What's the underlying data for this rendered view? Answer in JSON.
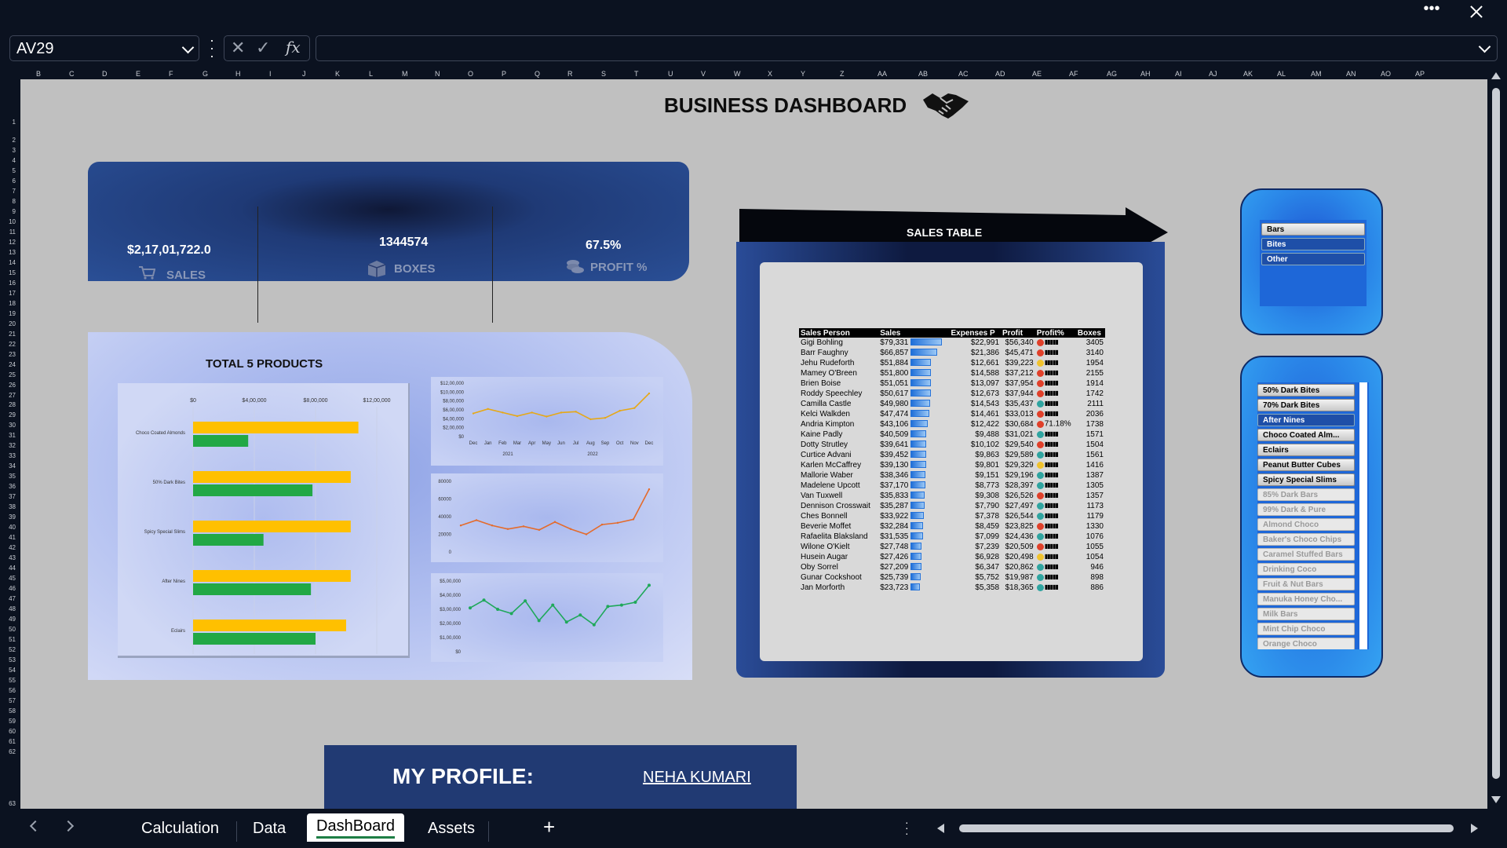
{
  "formula_bar": {
    "name_box": "AV29",
    "fx_label": "fx",
    "formula": ""
  },
  "columns": [
    "B",
    "C",
    "D",
    "E",
    "F",
    "G",
    "H",
    "I",
    "J",
    "K",
    "L",
    "M",
    "N",
    "O",
    "P",
    "Q",
    "R",
    "S",
    "T",
    "U",
    "V",
    "W",
    "X",
    "Y",
    "Z",
    "AA",
    "AB",
    "AC",
    "AD",
    "AE",
    "AF",
    "AG",
    "AH",
    "AI",
    "AJ",
    "AK",
    "AL",
    "AM",
    "AN",
    "AO",
    "AP"
  ],
  "rows": [
    "1",
    "2",
    "3",
    "4",
    "5",
    "6",
    "7",
    "8",
    "9",
    "10",
    "11",
    "12",
    "13",
    "14",
    "15",
    "16",
    "17",
    "18",
    "19",
    "20",
    "21",
    "22",
    "23",
    "24",
    "25",
    "26",
    "27",
    "28",
    "29",
    "30",
    "31",
    "32",
    "33",
    "34",
    "35",
    "36",
    "37",
    "38",
    "39",
    "40",
    "41",
    "42",
    "43",
    "44",
    "45",
    "46",
    "47",
    "48",
    "49",
    "50",
    "51",
    "52",
    "53",
    "54",
    "55",
    "56",
    "57",
    "58",
    "59",
    "60",
    "61",
    "62",
    "63"
  ],
  "dashboard": {
    "title": "BUSINESS DASHBOARD",
    "kpis": {
      "sales_value": "$2,17,01,722.0",
      "sales_label": "SALES",
      "boxes_value": "1344574",
      "boxes_label": "BOXES",
      "profit_value": "67.5%",
      "profit_label": "PROFIT %"
    },
    "products_title": "TOTAL 5 PRODUCTS",
    "sales_table_title": "SALES TABLE",
    "profile_label": "MY PROFILE:",
    "profile_name": "NEHA KUMARI"
  },
  "chart_data": [
    {
      "type": "bar",
      "title": "TOTAL 5 PRODUCTS",
      "categories": [
        "Choco Coated Almonds",
        "50% Dark Bites",
        "Spicy Special Slims",
        "After Nines",
        "Eclairs"
      ],
      "x_ticks": [
        "$0",
        "$4,00,000",
        "$8,00,000",
        "$12,00,000"
      ],
      "xlim": [
        0,
        1200000
      ],
      "series": [
        {
          "values": [
            1080000,
            1030000,
            1030000,
            1030000,
            1000000
          ],
          "color": "#FFC000"
        },
        {
          "values": [
            360000,
            780000,
            460000,
            770000,
            800000
          ],
          "color": "#22A845"
        }
      ]
    },
    {
      "type": "line",
      "categories": [
        "Dec",
        "Jan",
        "Feb",
        "Mar",
        "Apr",
        "May",
        "Jun",
        "Jul",
        "Aug",
        "Sep",
        "Oct",
        "Nov",
        "Dec"
      ],
      "group_labels": [
        "2021",
        "2022"
      ],
      "y_ticks": [
        "$0",
        "$2,00,000",
        "$4,00,000",
        "$6,00,000",
        "$8,00,000",
        "$10,00,000",
        "$12,00,000"
      ],
      "ylim": [
        0,
        1200000
      ],
      "series": [
        {
          "values": [
            520000,
            620000,
            540000,
            460000,
            540000,
            450000,
            540000,
            560000,
            390000,
            420000,
            580000,
            640000,
            970000
          ],
          "color": "#E6A817"
        }
      ]
    },
    {
      "type": "line",
      "y_ticks": [
        "0",
        "20000",
        "40000",
        "60000",
        "80000"
      ],
      "ylim": [
        0,
        80000
      ],
      "series": [
        {
          "values": [
            30000,
            36000,
            30000,
            26000,
            29000,
            25000,
            34000,
            26000,
            20000,
            31000,
            33000,
            37000,
            71000
          ],
          "color": "#E46B2C"
        }
      ]
    },
    {
      "type": "line",
      "y_ticks": [
        "$0",
        "$1,00,000",
        "$2,00,000",
        "$3,00,000",
        "$4,00,000",
        "$5,00,000"
      ],
      "ylim": [
        0,
        500000
      ],
      "series": [
        {
          "values": [
            310000,
            365000,
            300000,
            270000,
            360000,
            220000,
            330000,
            210000,
            260000,
            190000,
            320000,
            330000,
            350000,
            470000
          ],
          "color": "#1FA85A"
        }
      ]
    }
  ],
  "sales_table": {
    "headers": [
      "Sales Person",
      "Sales",
      "Expenses P",
      "Profit",
      "Profit%",
      "Boxes"
    ],
    "rows": [
      {
        "name": "Gigi Bohling",
        "sales": "$79,331",
        "exp": "$22,991",
        "profit": "$56,340",
        "pct": "",
        "dot": "#E0402A",
        "boxes": "3405",
        "bar": 1.0
      },
      {
        "name": "Barr Faughny",
        "sales": "$66,857",
        "exp": "$21,386",
        "profit": "$45,471",
        "pct": "",
        "dot": "#E0402A",
        "boxes": "3140",
        "bar": 0.84
      },
      {
        "name": "Jehu Rudeforth",
        "sales": "$51,884",
        "exp": "$12,661",
        "profit": "$39,223",
        "pct": "",
        "dot": "#F0C22D",
        "boxes": "1954",
        "bar": 0.65
      },
      {
        "name": "Mamey O'Breen",
        "sales": "$51,800",
        "exp": "$14,588",
        "profit": "$37,212",
        "pct": "",
        "dot": "#E0402A",
        "boxes": "2155",
        "bar": 0.65
      },
      {
        "name": "Brien Boise",
        "sales": "$51,051",
        "exp": "$13,097",
        "profit": "$37,954",
        "pct": "",
        "dot": "#E0402A",
        "boxes": "1914",
        "bar": 0.64
      },
      {
        "name": "Roddy Speechley",
        "sales": "$50,617",
        "exp": "$12,673",
        "profit": "$37,944",
        "pct": "",
        "dot": "#E0402A",
        "boxes": "1742",
        "bar": 0.64
      },
      {
        "name": "Camilla Castle",
        "sales": "$49,980",
        "exp": "$14,543",
        "profit": "$35,437",
        "pct": "",
        "dot": "#2FA4A0",
        "boxes": "2111",
        "bar": 0.63
      },
      {
        "name": "Kelci Walkden",
        "sales": "$47,474",
        "exp": "$14,461",
        "profit": "$33,013",
        "pct": "",
        "dot": "#E0402A",
        "boxes": "2036",
        "bar": 0.6
      },
      {
        "name": "Andria Kimpton",
        "sales": "$43,106",
        "exp": "$12,422",
        "profit": "$30,684",
        "pct": "71.18%",
        "dot": "#E0402A",
        "boxes": "1738",
        "bar": 0.54
      },
      {
        "name": "Kaine Padly",
        "sales": "$40,509",
        "exp": "$9,488",
        "profit": "$31,021",
        "pct": "",
        "dot": "#2FA4A0",
        "boxes": "1571",
        "bar": 0.51
      },
      {
        "name": "Dotty Strutley",
        "sales": "$39,641",
        "exp": "$10,102",
        "profit": "$29,540",
        "pct": "",
        "dot": "#E0402A",
        "boxes": "1504",
        "bar": 0.5
      },
      {
        "name": "Curtice Advani",
        "sales": "$39,452",
        "exp": "$9,863",
        "profit": "$29,589",
        "pct": "",
        "dot": "#2FA4A0",
        "boxes": "1561",
        "bar": 0.5
      },
      {
        "name": "Karlen McCaffrey",
        "sales": "$39,130",
        "exp": "$9,801",
        "profit": "$29,329",
        "pct": "",
        "dot": "#F0C22D",
        "boxes": "1416",
        "bar": 0.49
      },
      {
        "name": "Mallorie Waber",
        "sales": "$38,346",
        "exp": "$9,151",
        "profit": "$29,196",
        "pct": "",
        "dot": "#2FA4A0",
        "boxes": "1387",
        "bar": 0.48
      },
      {
        "name": "Madelene Upcott",
        "sales": "$37,170",
        "exp": "$8,773",
        "profit": "$28,397",
        "pct": "",
        "dot": "#2FA4A0",
        "boxes": "1305",
        "bar": 0.47
      },
      {
        "name": "Van Tuxwell",
        "sales": "$35,833",
        "exp": "$9,308",
        "profit": "$26,526",
        "pct": "",
        "dot": "#E0402A",
        "boxes": "1357",
        "bar": 0.45
      },
      {
        "name": "Dennison Crosswait",
        "sales": "$35,287",
        "exp": "$7,790",
        "profit": "$27,497",
        "pct": "",
        "dot": "#2FA4A0",
        "boxes": "1173",
        "bar": 0.44
      },
      {
        "name": "Ches Bonnell",
        "sales": "$33,922",
        "exp": "$7,378",
        "profit": "$26,544",
        "pct": "",
        "dot": "#2FA4A0",
        "boxes": "1179",
        "bar": 0.43
      },
      {
        "name": "Beverie Moffet",
        "sales": "$32,284",
        "exp": "$8,459",
        "profit": "$23,825",
        "pct": "",
        "dot": "#E0402A",
        "boxes": "1330",
        "bar": 0.41
      },
      {
        "name": "Rafaelita Blaksland",
        "sales": "$31,535",
        "exp": "$7,099",
        "profit": "$24,436",
        "pct": "",
        "dot": "#2FA4A0",
        "boxes": "1076",
        "bar": 0.4
      },
      {
        "name": "Wilone O'Kielt",
        "sales": "$27,748",
        "exp": "$7,239",
        "profit": "$20,509",
        "pct": "",
        "dot": "#E0402A",
        "boxes": "1055",
        "bar": 0.35
      },
      {
        "name": "Husein Augar",
        "sales": "$27,426",
        "exp": "$6,928",
        "profit": "$20,498",
        "pct": "",
        "dot": "#F0C22D",
        "boxes": "1054",
        "bar": 0.35
      },
      {
        "name": "Oby Sorrel",
        "sales": "$27,209",
        "exp": "$6,347",
        "profit": "$20,862",
        "pct": "",
        "dot": "#2FA4A0",
        "boxes": "946",
        "bar": 0.34
      },
      {
        "name": "Gunar Cockshoot",
        "sales": "$25,739",
        "exp": "$5,752",
        "profit": "$19,987",
        "pct": "",
        "dot": "#2FA4A0",
        "boxes": "898",
        "bar": 0.32
      },
      {
        "name": "Jan Morforth",
        "sales": "$23,723",
        "exp": "$5,358",
        "profit": "$18,365",
        "pct": "",
        "dot": "#2FA4A0",
        "boxes": "886",
        "bar": 0.3
      }
    ]
  },
  "category_slicer": {
    "items": [
      "Bars",
      "Bites",
      "Other"
    ]
  },
  "product_slicer": {
    "items": [
      {
        "label": "50% Dark Bites",
        "state": "sel"
      },
      {
        "label": "70% Dark Bites",
        "state": "sel"
      },
      {
        "label": "After Nines",
        "state": "sel2"
      },
      {
        "label": "Choco Coated Alm...",
        "state": "sel"
      },
      {
        "label": "Eclairs",
        "state": "sel"
      },
      {
        "label": "Peanut Butter Cubes",
        "state": "sel"
      },
      {
        "label": "Spicy Special Slims",
        "state": "sel"
      },
      {
        "label": "85% Dark Bars",
        "state": "off"
      },
      {
        "label": "99% Dark & Pure",
        "state": "off"
      },
      {
        "label": "Almond Choco",
        "state": "off"
      },
      {
        "label": "Baker's Choco Chips",
        "state": "off"
      },
      {
        "label": "Caramel Stuffed Bars",
        "state": "off"
      },
      {
        "label": "Drinking Coco",
        "state": "off"
      },
      {
        "label": "Fruit & Nut Bars",
        "state": "off"
      },
      {
        "label": "Manuka Honey Cho...",
        "state": "off"
      },
      {
        "label": "Milk Bars",
        "state": "off"
      },
      {
        "label": "Mint Chip Choco",
        "state": "off"
      },
      {
        "label": "Orange Choco",
        "state": "off"
      }
    ]
  },
  "sheet_tabs": [
    "Calculation",
    "Data",
    "DashBoard",
    "Assets"
  ],
  "active_tab": "DashBoard",
  "add_sheet": "+",
  "colors": {
    "accent_green": "#1E7E45",
    "gold": "#FFC000",
    "green": "#22A845",
    "navy": "#213A73"
  }
}
